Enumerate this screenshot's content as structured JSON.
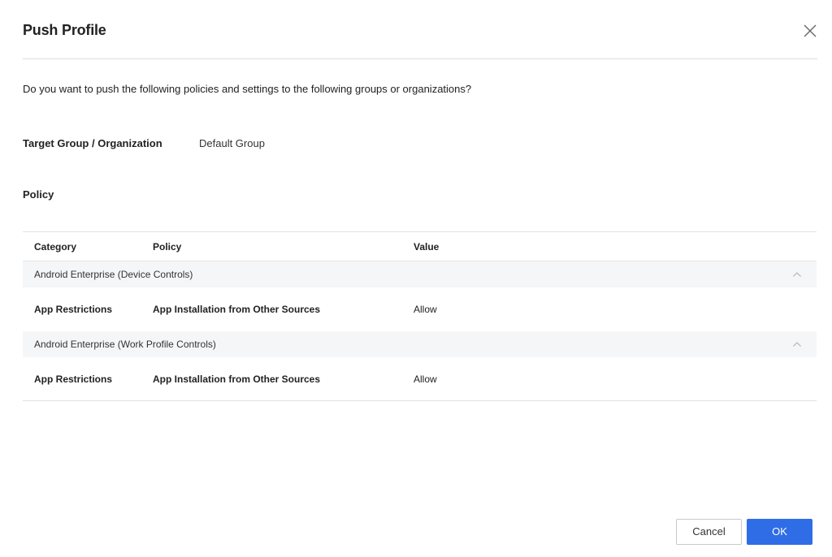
{
  "dialog": {
    "title": "Push Profile",
    "question": "Do you want to push the following policies and settings to the following groups or organizations?",
    "target_label": "Target Group / Organization",
    "target_value": "Default Group",
    "policy_heading": "Policy"
  },
  "table": {
    "columns": [
      "Category",
      "Policy",
      "Value"
    ],
    "groups": [
      {
        "name": "Android Enterprise (Device Controls)",
        "rows": [
          {
            "category": "App Restrictions",
            "policy": "App Installation from Other Sources",
            "value": "Allow"
          }
        ]
      },
      {
        "name": "Android Enterprise (Work Profile Controls)",
        "rows": [
          {
            "category": "App Restrictions",
            "policy": "App Installation from Other Sources",
            "value": "Allow"
          }
        ]
      }
    ]
  },
  "buttons": {
    "cancel_label": "Cancel",
    "ok_label": "OK"
  },
  "icons": {
    "close": "close-icon",
    "collapse": "chevron-up-icon"
  },
  "colors": {
    "primary": "#2f6de6",
    "group_bg": "#f5f6f7"
  }
}
